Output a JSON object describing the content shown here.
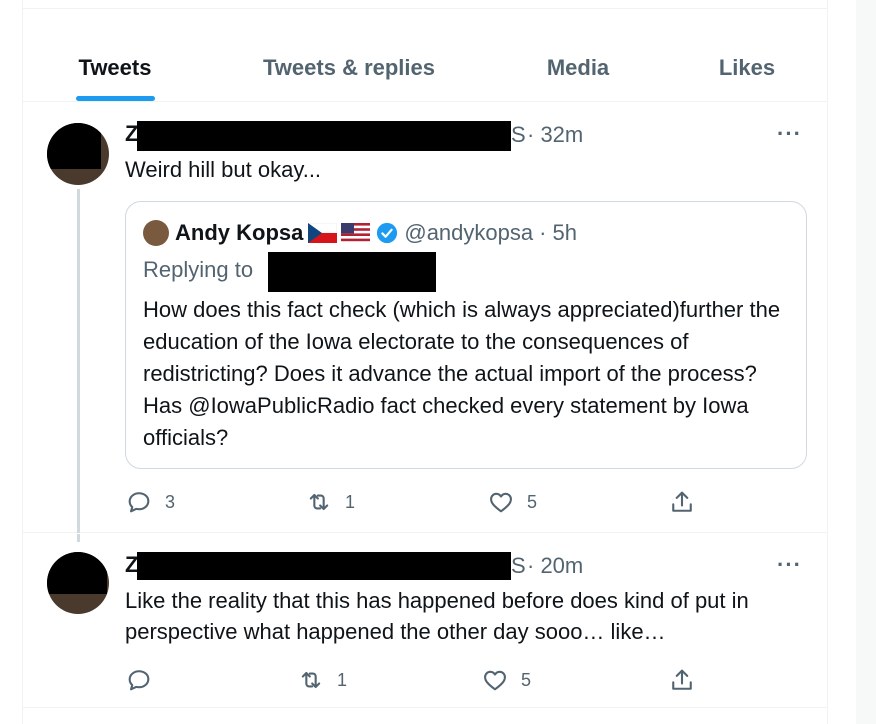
{
  "tabs": [
    {
      "label": "Tweets",
      "active": true
    },
    {
      "label": "Tweets & replies",
      "active": false
    },
    {
      "label": "Media",
      "active": false
    },
    {
      "label": "Likes",
      "active": false
    }
  ],
  "tweets": [
    {
      "name_visible_start": "Z",
      "name_visible_end": "S",
      "time": "· 32m",
      "more": "···",
      "text": "Weird hill but okay...",
      "quote": {
        "author_name": "Andy Kopsa",
        "handle": "@andykopsa",
        "time": "· 5h",
        "replying_to": "Replying to",
        "text": "How does this fact check (which is always appreciated)further the education of the Iowa electorate to the consequences of redistricting?   Does it advance the actual import of the process? Has @IowaPublicRadio fact checked every statement by Iowa officials?"
      },
      "actions": {
        "replies": "3",
        "retweets": "1",
        "likes": "5"
      }
    },
    {
      "name_visible_start": "Z",
      "name_visible_end": "S",
      "time": "· 20m",
      "more": "···",
      "text": "Like the reality that this has happened before does kind of put in perspective what happened the other day sooo… like…",
      "actions": {
        "replies": "",
        "retweets": "1",
        "likes": "5"
      }
    }
  ],
  "colors": {
    "accent": "#1d9bf0",
    "muted": "#536471",
    "border": "#cfd9de"
  },
  "icons": [
    "reply-icon",
    "retweet-icon",
    "like-icon",
    "share-icon",
    "verified-badge-icon",
    "czech-flag-icon",
    "us-flag-icon"
  ]
}
